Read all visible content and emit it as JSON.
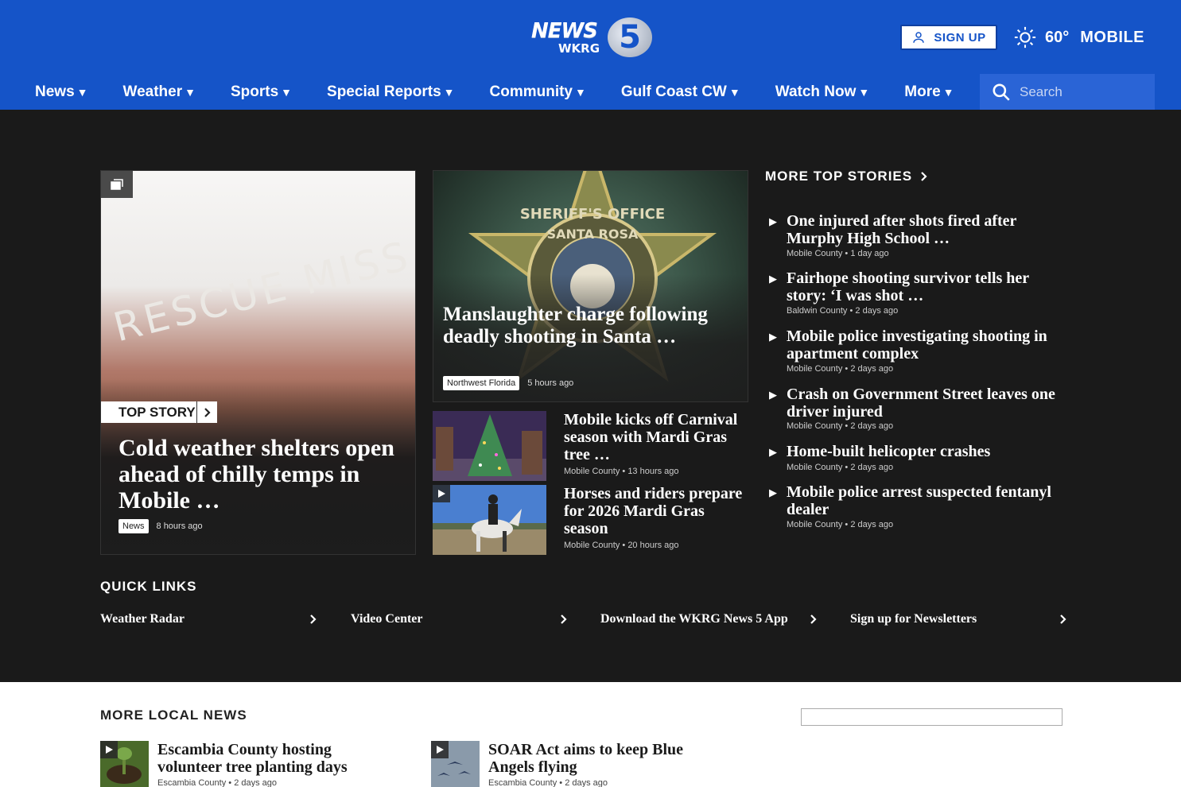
{
  "header": {
    "logo_text": "NEWS",
    "logo_sub": "WKRG",
    "logo_number": "5",
    "signup_label": "SIGN UP",
    "weather": {
      "temp": "60°",
      "city": "MOBILE",
      "icon": "sun-icon"
    }
  },
  "nav": {
    "items": [
      {
        "label": "News"
      },
      {
        "label": "Weather"
      },
      {
        "label": "Sports"
      },
      {
        "label": "Special Reports"
      },
      {
        "label": "Community"
      },
      {
        "label": "Gulf Coast CW"
      },
      {
        "label": "Watch Now"
      },
      {
        "label": "More"
      }
    ],
    "caret": "▼",
    "search_placeholder": "Search"
  },
  "top_story": {
    "tag": "TOP STORY",
    "sign_text": "RESCUE MISS",
    "headline": "Cold weather shelters open ahead of chilly temps in Mobile …",
    "category": "News",
    "time": "8 hours ago"
  },
  "second_story": {
    "headline": "Manslaughter charge following deadly shooting in Santa …",
    "category": "Northwest Florida",
    "time": "5 hours ago",
    "badge_top": "SHERIFF'S OFFICE",
    "badge_sub": "SANTA ROSA"
  },
  "mini_stories": [
    {
      "title": "Mobile kicks off Carnival season with Mardi Gras tree …",
      "location": "Mobile County",
      "time": "13 hours ago"
    },
    {
      "title": "Horses and riders prepare for 2026 Mardi Gras season",
      "location": "Mobile County",
      "time": "20 hours ago"
    }
  ],
  "more_top_stories": {
    "header": "MORE TOP STORIES",
    "items": [
      {
        "title": "One injured after shots fired after Murphy High School …",
        "location": "Mobile County",
        "time": "1 day ago"
      },
      {
        "title": "Fairhope shooting survivor tells her story: ‘I was shot …",
        "location": "Baldwin County",
        "time": "2 days ago"
      },
      {
        "title": "Mobile police investigating shooting in apartment complex",
        "location": "Mobile County",
        "time": "2 days ago"
      },
      {
        "title": "Crash on Government Street leaves one driver injured",
        "location": "Mobile County",
        "time": "2 days ago"
      },
      {
        "title": "Home-built helicopter crashes",
        "location": "Mobile County",
        "time": "2 days ago"
      },
      {
        "title": "Mobile police arrest suspected fentanyl dealer",
        "location": "Mobile County",
        "time": "2 days ago"
      }
    ]
  },
  "quick_links": {
    "header": "QUICK LINKS",
    "items": [
      {
        "label": "Weather Radar"
      },
      {
        "label": "Video Center"
      },
      {
        "label": "Download the WKRG News 5 App"
      },
      {
        "label": "Sign up for Newsletters"
      }
    ]
  },
  "more_local_news": {
    "header": "MORE LOCAL NEWS",
    "items": [
      {
        "title": "Escambia County hosting volunteer tree planting days",
        "location": "Escambia County",
        "time": "2 days ago"
      },
      {
        "title": "SOAR Act aims to keep Blue Angels flying",
        "location": "Escambia County",
        "time": "2 days ago"
      }
    ]
  },
  "meta_separator": "•",
  "colors": {
    "brand_blue": "#1554c8",
    "dark_bg": "#1a1a1a"
  }
}
